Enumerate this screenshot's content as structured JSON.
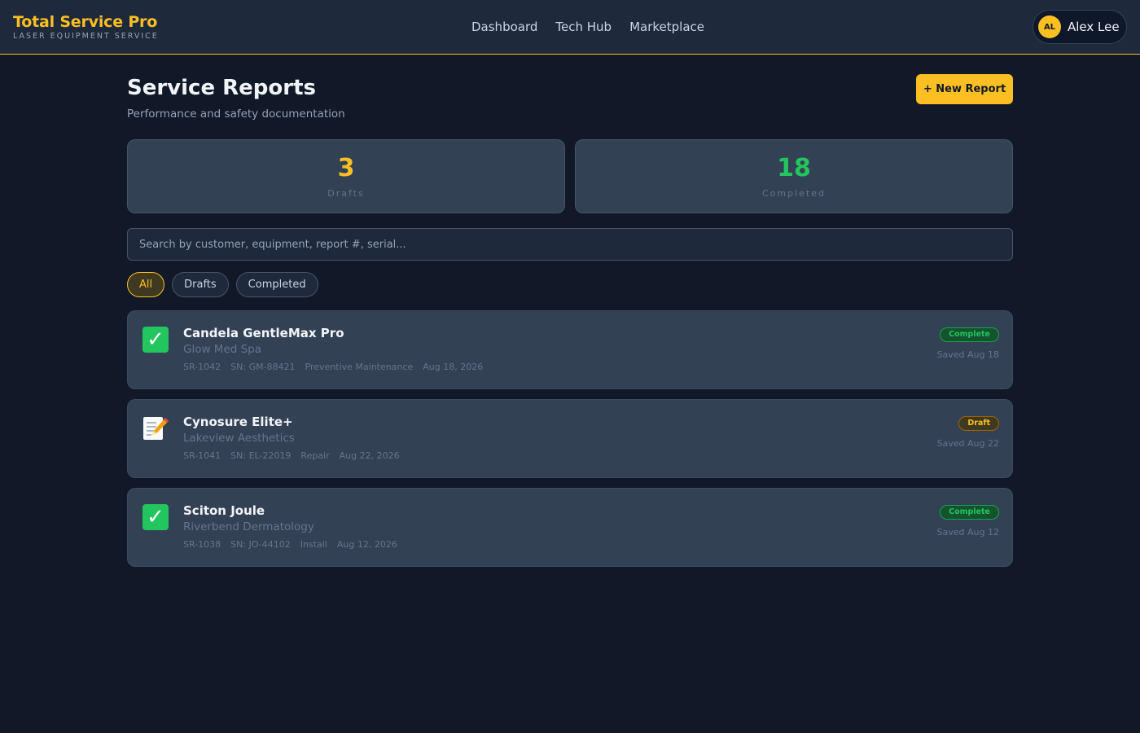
{
  "brand": {
    "title": "Total Service Pro",
    "subtitle": "LASER EQUIPMENT SERVICE"
  },
  "nav": {
    "items": [
      "Dashboard",
      "Tech Hub",
      "Marketplace"
    ]
  },
  "user": {
    "initials": "AL",
    "name": "Alex Lee"
  },
  "page": {
    "title": "Service Reports",
    "subtitle": "Performance and safety documentation",
    "new_button": "+ New Report"
  },
  "stats": [
    {
      "value": "3",
      "label": "Drafts",
      "color": "#fbbf24"
    },
    {
      "value": "18",
      "label": "Completed",
      "color": "#22c55e"
    }
  ],
  "search": {
    "placeholder": "Search by customer, equipment, report #, serial..."
  },
  "filters": [
    {
      "label": "All",
      "active": true
    },
    {
      "label": "Drafts",
      "active": false
    },
    {
      "label": "Completed",
      "active": false
    }
  ],
  "reports": [
    {
      "icon": "check-icon",
      "title": "Candela GentleMax Pro",
      "customer": "Glow Med Spa",
      "id": "SR-1042",
      "serial": "SN: GM-88421",
      "type": "Preventive Maintenance",
      "date": "Aug 18, 2026",
      "status": "Complete",
      "saved": "Saved Aug 18"
    },
    {
      "icon": "memo-icon",
      "title": "Cynosure Elite+",
      "customer": "Lakeview Aesthetics",
      "id": "SR-1041",
      "serial": "SN: EL-22019",
      "type": "Repair",
      "date": "Aug 22, 2026",
      "status": "Draft",
      "saved": "Saved Aug 22"
    },
    {
      "icon": "check-icon",
      "title": "Sciton Joule",
      "customer": "Riverbend Dermatology",
      "id": "SR-1038",
      "serial": "SN: JO-44102",
      "type": "Install",
      "date": "Aug 12, 2026",
      "status": "Complete",
      "saved": "Saved Aug 12"
    }
  ]
}
